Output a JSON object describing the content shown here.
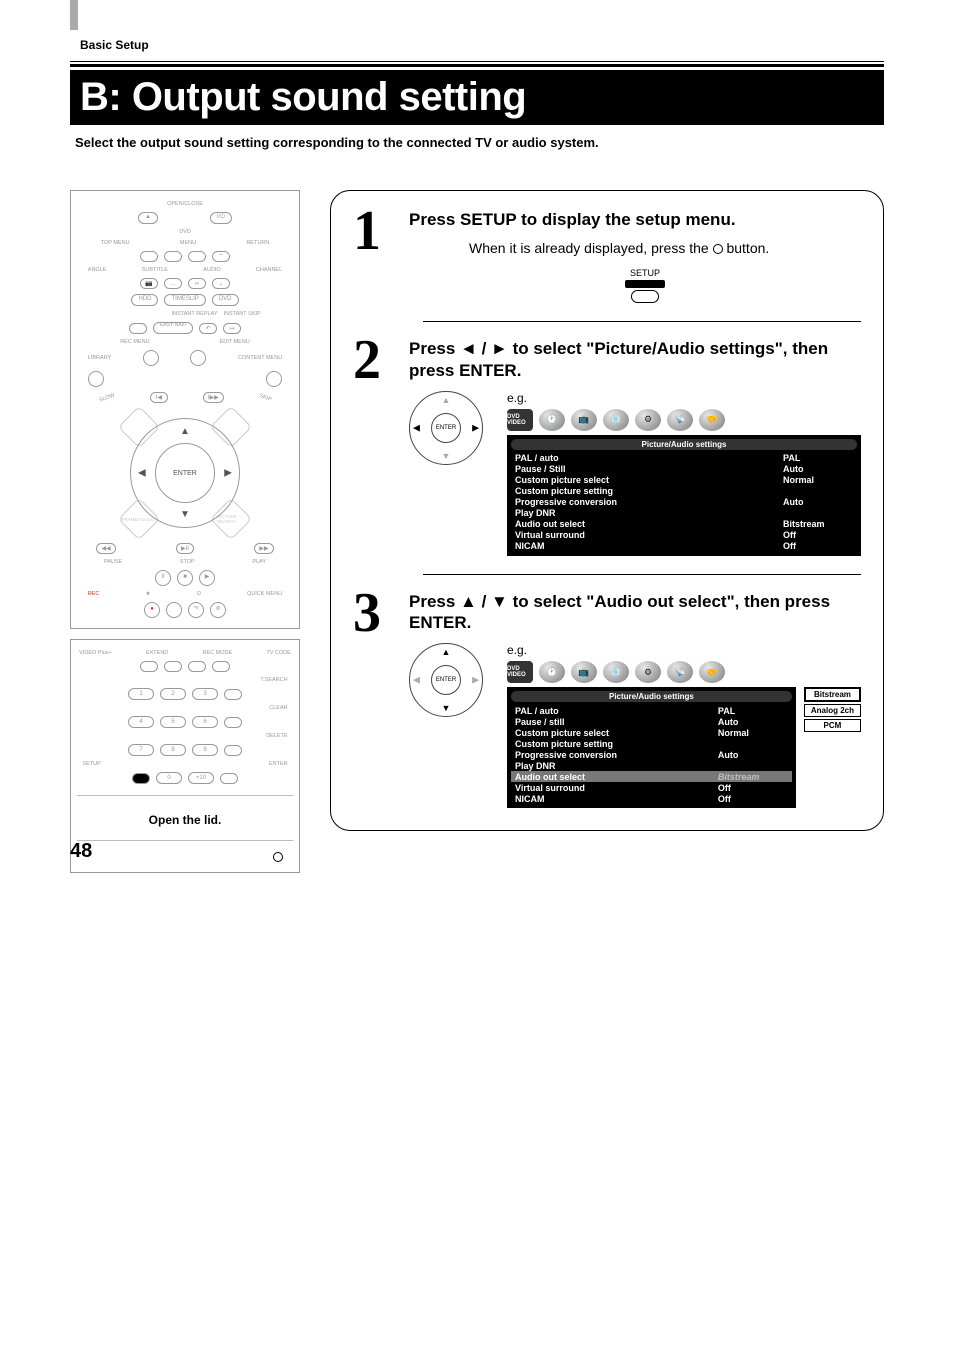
{
  "header": {
    "section": "Basic Setup",
    "title": "B: Output sound setting"
  },
  "intro": "Select the output sound setting corresponding to the connected TV or audio system.",
  "remote": {
    "open_close": "OPEN/CLOSE",
    "dvd": "DVD",
    "top_menu": "TOP MENU",
    "menu": "MENU",
    "return": "RETURN",
    "angle": "ANGLE",
    "subtitle": "SUBTITLE",
    "audio": "AUDIO",
    "channel": "CHANNEL",
    "hdd": "HDD",
    "timeslip": "TIMESLIP",
    "dvd_btn": "DVD",
    "instant_replay": "INSTANT REPLAY",
    "instant_skip": "INSTANT SKIP",
    "easy_navi": "EASY\nNAVI",
    "rec_menu": "REC MENU",
    "edit_menu": "EDIT MENU",
    "library": "LIBRARY",
    "content_menu": "CONTENT MENU",
    "slow": "SLOW",
    "skip": "SKIP",
    "enter": "ENTER",
    "frame_adjust": "FRAME/ADJUST",
    "picture_search": "PICTURE SEARCH",
    "pause": "PAUSE",
    "stop": "STOP",
    "play": "PLAY",
    "rec": "REC",
    "star": "★",
    "o": "O",
    "quick_menu": "QUICK MENU",
    "video_plus": "VIDEO Plus+",
    "extend": "EXTEND",
    "rec_mode": "REC MODE",
    "tv_code": "TV CODE",
    "tsearch": "T.SEARCH",
    "clear": "CLEAR",
    "delete": "DELETE",
    "setup": "SETUP",
    "enter_b": "ENTER",
    "nums": {
      "n1": "1",
      "n2": "2",
      "n3": "3",
      "n4": "4",
      "n5": "5",
      "n6": "6",
      "n7": "7",
      "n8": "8",
      "n9": "9",
      "n0": "0",
      "n10": "+10"
    },
    "open_lid": "Open the lid."
  },
  "steps": {
    "s1": {
      "num": "1",
      "title": "Press SETUP to display the setup menu.",
      "note_pre": "When it is already displayed, press the ",
      "note_post": " button.",
      "setup_label": "SETUP"
    },
    "s2": {
      "num": "2",
      "title": "Press ◄ / ► to select \"Picture/Audio settings\", then press ENTER.",
      "eg": "e.g.",
      "enter": "ENTER"
    },
    "s3": {
      "num": "3",
      "title": "Press ▲ / ▼ to select \"Audio out select\", then press ENTER.",
      "eg": "e.g.",
      "enter": "ENTER",
      "options": {
        "o1": "Bitstream",
        "o2": "Analog 2ch",
        "o3": "PCM"
      }
    }
  },
  "osd": {
    "dvd_video": "DVD\nVIDEO",
    "panel_title": "Picture/Audio settings",
    "rows2": [
      {
        "k": "PAL / auto",
        "v": "PAL"
      },
      {
        "k": "Pause / Still",
        "v": "Auto"
      },
      {
        "k": "Custom picture select",
        "v": "Normal"
      },
      {
        "k": "Custom picture setting",
        "v": ""
      },
      {
        "k": "Progressive conversion",
        "v": "Auto"
      },
      {
        "k": "Play DNR",
        "v": ""
      },
      {
        "k": "Audio out select",
        "v": "Bitstream"
      },
      {
        "k": "Virtual surround",
        "v": "Off"
      },
      {
        "k": "NICAM",
        "v": "Off"
      }
    ],
    "rows3": [
      {
        "k": "PAL / auto",
        "v": "PAL"
      },
      {
        "k": "Pause / still",
        "v": "Auto"
      },
      {
        "k": "Custom picture select",
        "v": "Normal"
      },
      {
        "k": "Custom picture setting",
        "v": ""
      },
      {
        "k": "Progressive conversion",
        "v": "Auto"
      },
      {
        "k": "Play DNR",
        "v": ""
      },
      {
        "k": "Audio out select",
        "v": "Bitstream",
        "hl": true
      },
      {
        "k": "Virtual surround",
        "v": "Off"
      },
      {
        "k": "NICAM",
        "v": "Off"
      }
    ]
  },
  "page_number": "48"
}
